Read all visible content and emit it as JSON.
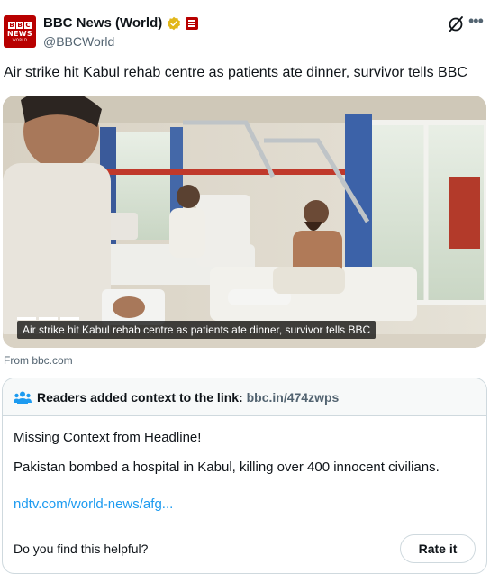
{
  "author": {
    "avatar_logo": {
      "letters": [
        "B",
        "B",
        "C"
      ],
      "line1": "NEWS",
      "line2": "WORLD"
    },
    "display_name": "BBC News (World)",
    "handle": "@BBCWorld",
    "verified_badge": "gold-check-icon",
    "affiliate_badge": "bbc-affiliate-icon"
  },
  "header_actions": {
    "grok_icon": "grok-icon",
    "more_icon": "more-icon"
  },
  "tweet": {
    "text": "Air strike hit Kabul rehab centre as patients ate dinner, survivor tells BBC"
  },
  "media": {
    "caption": "Air strike hit Kabul rehab centre as patients ate dinner, survivor tells BBC",
    "source": "From bbc.com"
  },
  "community_note": {
    "title": "Readers added context to the link:",
    "title_link": "bbc.in/474zwps",
    "line1": "Missing Context from Headline!",
    "line2": "Pakistan bombed a hospital in Kabul, killing over 400 innocent civilians.",
    "link": "ndtv.com/world-news/afg...",
    "helpful_question": "Do you find this helpful?",
    "rate_button": "Rate it"
  },
  "colors": {
    "bbc_red": "#b80000",
    "link_blue": "#1d9bf0",
    "muted": "#536471",
    "gold": "#e2b719"
  }
}
